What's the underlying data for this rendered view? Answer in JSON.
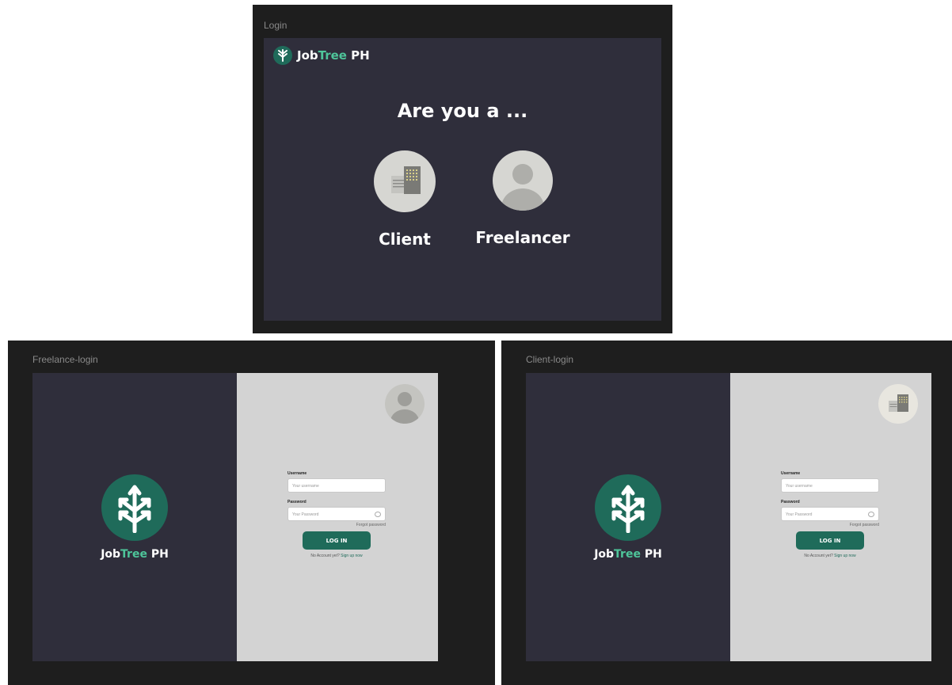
{
  "frames": {
    "login": {
      "label": "Login",
      "brand": {
        "part1": "Job",
        "part2": "Tree",
        "part3": " PH"
      },
      "question": "Are you a ...",
      "roles": [
        {
          "label": "Client",
          "icon": "building-icon"
        },
        {
          "label": "Freelancer",
          "icon": "person-icon"
        }
      ]
    },
    "freelance_login": {
      "label": "Freelance-login",
      "brand": {
        "part1": "Job",
        "part2": "Tree",
        "part3": " PH"
      },
      "avatar_icon": "person-icon",
      "form": {
        "username_label": "Username",
        "username_placeholder": "Your username",
        "password_label": "Password",
        "password_placeholder": "Your Password",
        "forgot": "Forgot password",
        "login_button": "LOG IN",
        "signup_prefix": "No Account yet? ",
        "signup_link": "Sign up now"
      }
    },
    "client_login": {
      "label": "Client-login",
      "brand": {
        "part1": "Job",
        "part2": "Tree",
        "part3": " PH"
      },
      "avatar_icon": "building-icon",
      "form": {
        "username_label": "Username",
        "username_placeholder": "Your username",
        "password_label": "Password",
        "password_placeholder": "Your Password",
        "forgot": "Forgot password",
        "login_button": "LOG IN",
        "signup_prefix": "No Account yet? ",
        "signup_link": "Sign up now"
      }
    }
  },
  "colors": {
    "frame_bg": "#1e1e1e",
    "panel_dark": "#2f2e3b",
    "panel_light": "#d3d3d3",
    "brand_green": "#1f6b5a",
    "accent_green": "#4ec59a"
  }
}
